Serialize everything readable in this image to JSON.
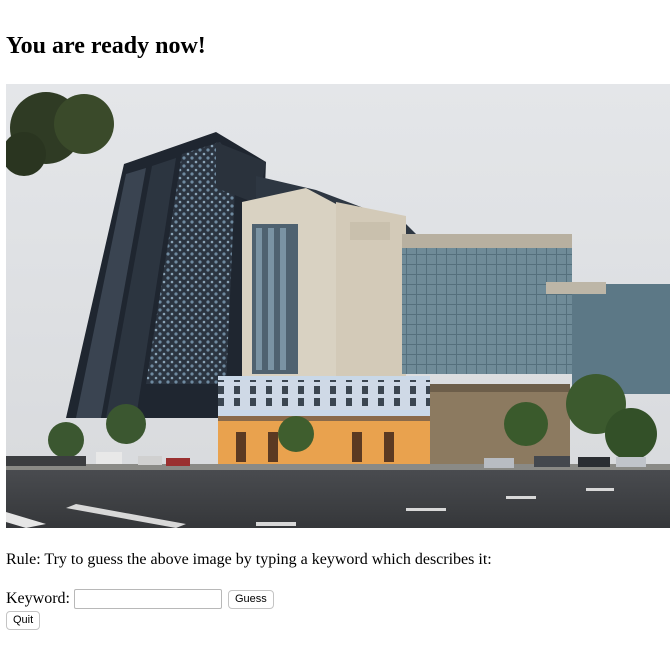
{
  "page": {
    "heading": "You are ready now!",
    "rule_text": "Rule: Try to guess the above image by typing a keyword which describes it:"
  },
  "form": {
    "keyword_label": "Keyword:",
    "keyword_value": "",
    "guess_label": "Guess",
    "quit_label": "Quit"
  }
}
